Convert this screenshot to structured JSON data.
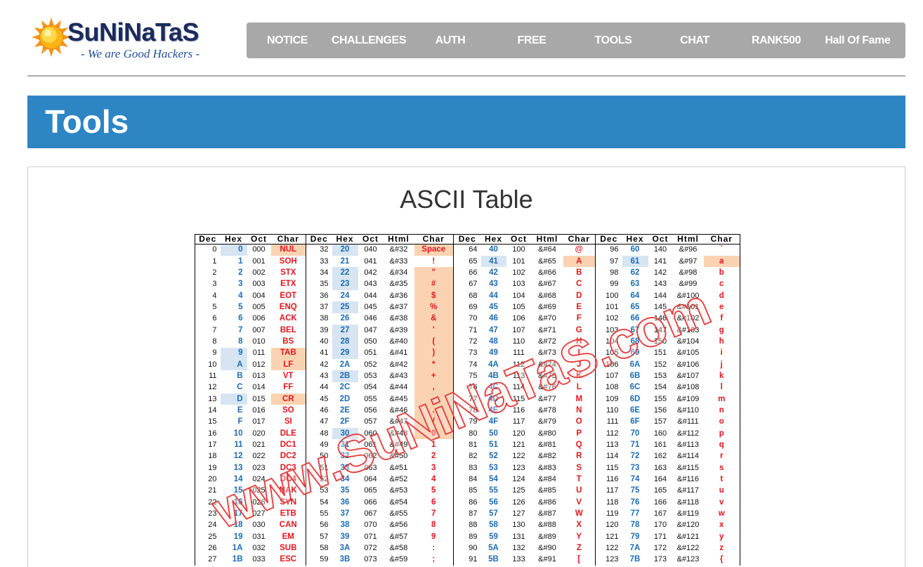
{
  "logo": {
    "icon": "sun-icon",
    "title": "SuNiNaTaS",
    "tagline": "- We are Good Hackers -"
  },
  "nav": {
    "items": [
      "NOTICE",
      "CHALLENGES",
      "AUTH",
      "FREE",
      "TOOLS",
      "CHAT",
      "RANK500",
      "Hall Of Fame"
    ]
  },
  "page": {
    "title": "Tools"
  },
  "content": {
    "title": "ASCII Table"
  },
  "ascii_table": {
    "watermark": "www.SuNiNaTaS.com",
    "highlight": {
      "hex": [
        0,
        9,
        10,
        13,
        32,
        34,
        35,
        37,
        39,
        40,
        41,
        43,
        48,
        65,
        97
      ],
      "char": [
        0,
        9,
        10,
        13,
        32,
        34,
        35,
        36,
        37,
        38,
        39,
        40,
        41,
        42,
        43,
        44,
        45,
        46,
        47,
        48,
        65,
        97
      ]
    },
    "groups": [
      {
        "headers": [
          "Dec",
          "Hex",
          "Oct",
          "Char"
        ],
        "rows": [
          [
            "0",
            "0",
            "000",
            "NUL"
          ],
          [
            "1",
            "1",
            "001",
            "SOH"
          ],
          [
            "2",
            "2",
            "002",
            "STX"
          ],
          [
            "3",
            "3",
            "003",
            "ETX"
          ],
          [
            "4",
            "4",
            "004",
            "EOT"
          ],
          [
            "5",
            "5",
            "005",
            "ENQ"
          ],
          [
            "6",
            "6",
            "006",
            "ACK"
          ],
          [
            "7",
            "7",
            "007",
            "BEL"
          ],
          [
            "8",
            "8",
            "010",
            "BS"
          ],
          [
            "9",
            "9",
            "011",
            "TAB"
          ],
          [
            "10",
            "A",
            "012",
            "LF"
          ],
          [
            "11",
            "B",
            "013",
            "VT"
          ],
          [
            "12",
            "C",
            "014",
            "FF"
          ],
          [
            "13",
            "D",
            "015",
            "CR"
          ],
          [
            "14",
            "E",
            "016",
            "SO"
          ],
          [
            "15",
            "F",
            "017",
            "SI"
          ],
          [
            "16",
            "10",
            "020",
            "DLE"
          ],
          [
            "17",
            "11",
            "021",
            "DC1"
          ],
          [
            "18",
            "12",
            "022",
            "DC2"
          ],
          [
            "19",
            "13",
            "023",
            "DC3"
          ],
          [
            "20",
            "14",
            "024",
            "DC4"
          ],
          [
            "21",
            "15",
            "025",
            "NAK"
          ],
          [
            "22",
            "16",
            "026",
            "SYN"
          ],
          [
            "23",
            "17",
            "027",
            "ETB"
          ],
          [
            "24",
            "18",
            "030",
            "CAN"
          ],
          [
            "25",
            "19",
            "031",
            "EM"
          ],
          [
            "26",
            "1A",
            "032",
            "SUB"
          ],
          [
            "27",
            "1B",
            "033",
            "ESC"
          ]
        ]
      },
      {
        "headers": [
          "Dec",
          "Hex",
          "Oct",
          "Html",
          "Char"
        ],
        "rows": [
          [
            "32",
            "20",
            "040",
            "&#32",
            "Space"
          ],
          [
            "33",
            "21",
            "041",
            "&#33",
            "!"
          ],
          [
            "34",
            "22",
            "042",
            "&#34",
            "\""
          ],
          [
            "35",
            "23",
            "043",
            "&#35",
            "#"
          ],
          [
            "36",
            "24",
            "044",
            "&#36",
            "$"
          ],
          [
            "37",
            "25",
            "045",
            "&#37",
            "%"
          ],
          [
            "38",
            "26",
            "046",
            "&#38",
            "&"
          ],
          [
            "39",
            "27",
            "047",
            "&#39",
            "'"
          ],
          [
            "40",
            "28",
            "050",
            "&#40",
            "("
          ],
          [
            "41",
            "29",
            "051",
            "&#41",
            ")"
          ],
          [
            "42",
            "2A",
            "052",
            "&#42",
            "*"
          ],
          [
            "43",
            "2B",
            "053",
            "&#43",
            "+"
          ],
          [
            "44",
            "2C",
            "054",
            "&#44",
            ","
          ],
          [
            "45",
            "2D",
            "055",
            "&#45",
            "-"
          ],
          [
            "46",
            "2E",
            "056",
            "&#46",
            "."
          ],
          [
            "47",
            "2F",
            "057",
            "&#47",
            "/"
          ],
          [
            "48",
            "30",
            "060",
            "&#48",
            "0"
          ],
          [
            "49",
            "31",
            "061",
            "&#49",
            "1"
          ],
          [
            "50",
            "32",
            "062",
            "&#50",
            "2"
          ],
          [
            "51",
            "33",
            "063",
            "&#51",
            "3"
          ],
          [
            "52",
            "34",
            "064",
            "&#52",
            "4"
          ],
          [
            "53",
            "35",
            "065",
            "&#53",
            "5"
          ],
          [
            "54",
            "36",
            "066",
            "&#54",
            "6"
          ],
          [
            "55",
            "37",
            "067",
            "&#55",
            "7"
          ],
          [
            "56",
            "38",
            "070",
            "&#56",
            "8"
          ],
          [
            "57",
            "39",
            "071",
            "&#57",
            "9"
          ],
          [
            "58",
            "3A",
            "072",
            "&#58",
            ":"
          ],
          [
            "59",
            "3B",
            "073",
            "&#59",
            ";"
          ]
        ]
      },
      {
        "headers": [
          "Dec",
          "Hex",
          "Oct",
          "Html",
          "Char"
        ],
        "rows": [
          [
            "64",
            "40",
            "100",
            "&#64",
            "@"
          ],
          [
            "65",
            "41",
            "101",
            "&#65",
            "A"
          ],
          [
            "66",
            "42",
            "102",
            "&#66",
            "B"
          ],
          [
            "67",
            "43",
            "103",
            "&#67",
            "C"
          ],
          [
            "68",
            "44",
            "104",
            "&#68",
            "D"
          ],
          [
            "69",
            "45",
            "105",
            "&#69",
            "E"
          ],
          [
            "70",
            "46",
            "106",
            "&#70",
            "F"
          ],
          [
            "71",
            "47",
            "107",
            "&#71",
            "G"
          ],
          [
            "72",
            "48",
            "110",
            "&#72",
            "H"
          ],
          [
            "73",
            "49",
            "111",
            "&#73",
            "I"
          ],
          [
            "74",
            "4A",
            "112",
            "&#74",
            "J"
          ],
          [
            "75",
            "4B",
            "113",
            "&#75",
            "K"
          ],
          [
            "76",
            "4C",
            "114",
            "&#76",
            "L"
          ],
          [
            "77",
            "4D",
            "115",
            "&#77",
            "M"
          ],
          [
            "78",
            "4E",
            "116",
            "&#78",
            "N"
          ],
          [
            "79",
            "4F",
            "117",
            "&#79",
            "O"
          ],
          [
            "80",
            "50",
            "120",
            "&#80",
            "P"
          ],
          [
            "81",
            "51",
            "121",
            "&#81",
            "Q"
          ],
          [
            "82",
            "52",
            "122",
            "&#82",
            "R"
          ],
          [
            "83",
            "53",
            "123",
            "&#83",
            "S"
          ],
          [
            "84",
            "54",
            "124",
            "&#84",
            "T"
          ],
          [
            "85",
            "55",
            "125",
            "&#85",
            "U"
          ],
          [
            "86",
            "56",
            "126",
            "&#86",
            "V"
          ],
          [
            "87",
            "57",
            "127",
            "&#87",
            "W"
          ],
          [
            "88",
            "58",
            "130",
            "&#88",
            "X"
          ],
          [
            "89",
            "59",
            "131",
            "&#89",
            "Y"
          ],
          [
            "90",
            "5A",
            "132",
            "&#90",
            "Z"
          ],
          [
            "91",
            "5B",
            "133",
            "&#91",
            "["
          ]
        ]
      },
      {
        "headers": [
          "Dec",
          "Hex",
          "Oct",
          "Html",
          "Char"
        ],
        "rows": [
          [
            "96",
            "60",
            "140",
            "&#96",
            "`"
          ],
          [
            "97",
            "61",
            "141",
            "&#97",
            "a"
          ],
          [
            "98",
            "62",
            "142",
            "&#98",
            "b"
          ],
          [
            "99",
            "63",
            "143",
            "&#99",
            "c"
          ],
          [
            "100",
            "64",
            "144",
            "&#100",
            "d"
          ],
          [
            "101",
            "65",
            "145",
            "&#101",
            "e"
          ],
          [
            "102",
            "66",
            "146",
            "&#102",
            "f"
          ],
          [
            "103",
            "67",
            "147",
            "&#103",
            "g"
          ],
          [
            "104",
            "68",
            "150",
            "&#104",
            "h"
          ],
          [
            "105",
            "69",
            "151",
            "&#105",
            "i"
          ],
          [
            "106",
            "6A",
            "152",
            "&#106",
            "j"
          ],
          [
            "107",
            "6B",
            "153",
            "&#107",
            "k"
          ],
          [
            "108",
            "6C",
            "154",
            "&#108",
            "l"
          ],
          [
            "109",
            "6D",
            "155",
            "&#109",
            "m"
          ],
          [
            "110",
            "6E",
            "156",
            "&#110",
            "n"
          ],
          [
            "111",
            "6F",
            "157",
            "&#111",
            "o"
          ],
          [
            "112",
            "70",
            "160",
            "&#112",
            "p"
          ],
          [
            "113",
            "71",
            "161",
            "&#113",
            "q"
          ],
          [
            "114",
            "72",
            "162",
            "&#114",
            "r"
          ],
          [
            "115",
            "73",
            "163",
            "&#115",
            "s"
          ],
          [
            "116",
            "74",
            "164",
            "&#116",
            "t"
          ],
          [
            "117",
            "75",
            "165",
            "&#117",
            "u"
          ],
          [
            "118",
            "76",
            "166",
            "&#118",
            "v"
          ],
          [
            "119",
            "77",
            "167",
            "&#119",
            "w"
          ],
          [
            "120",
            "78",
            "170",
            "&#120",
            "x"
          ],
          [
            "121",
            "79",
            "171",
            "&#121",
            "y"
          ],
          [
            "122",
            "7A",
            "172",
            "&#122",
            "z"
          ],
          [
            "123",
            "7B",
            "173",
            "&#123",
            "{"
          ]
        ]
      }
    ]
  },
  "colors": {
    "nav_bg": "#a8a8a8",
    "banner_bg": "#2d85c4",
    "hex_text": "#1b6cb5",
    "char_text": "#e4141b",
    "hex_highlight": "#d7e5f2",
    "char_highlight": "#fbd3b2",
    "watermark": "#e23b3b"
  }
}
